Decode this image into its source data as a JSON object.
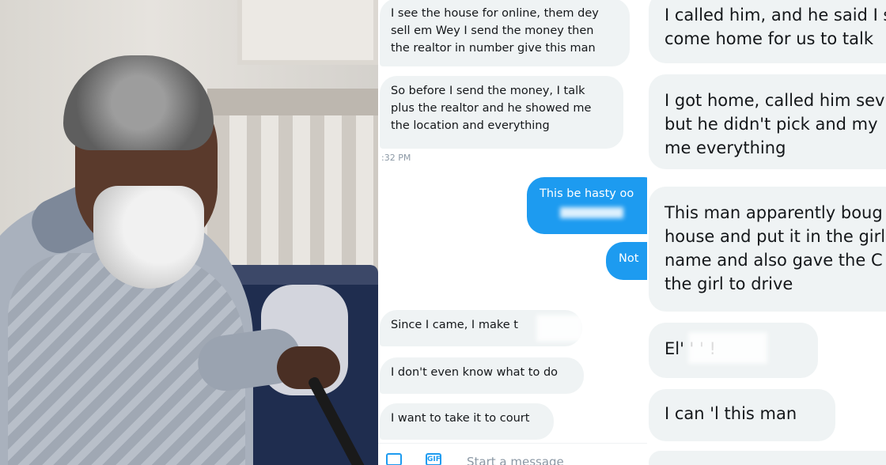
{
  "chat_middle": {
    "messages": [
      {
        "text_lines": [
          "I see the house for online, them dey",
          "sell em Wey I send the money then",
          "the realtor in number give this man"
        ]
      },
      {
        "text_lines": [
          "So before I send the money, I talk",
          "plus the realtor and he showed me",
          "the location and everything"
        ]
      },
      {
        "text": "Since I came, I make t"
      },
      {
        "text": "I don't even know what to do"
      },
      {
        "text": "I want to take it to court"
      }
    ],
    "timestamp": ":32 PM",
    "sent": [
      {
        "text": "This be hasty oo"
      },
      {
        "text": "Not"
      }
    ],
    "composer": {
      "placeholder": "Start a message",
      "image_icon": "image-icon",
      "gif_label": "GIF"
    }
  },
  "chat_right": {
    "messages": [
      {
        "text_lines": [
          "I called him, and he said I s",
          "come home for us to talk"
        ]
      },
      {
        "text_lines": [
          "I got home, called him sev",
          "but he didn't pick and my",
          "me everything"
        ]
      },
      {
        "text_lines": [
          "This man apparently boug",
          "house and put it in the girl",
          "name and also gave the C",
          "the girl to drive"
        ]
      },
      {
        "text": "El'   '   '  !"
      },
      {
        "text": "I can   'l this man"
      }
    ]
  },
  "colors": {
    "incoming_bubble": "#eff3f4",
    "outgoing_bubble": "#1d9bf0",
    "timestamp": "#8b98a5"
  }
}
